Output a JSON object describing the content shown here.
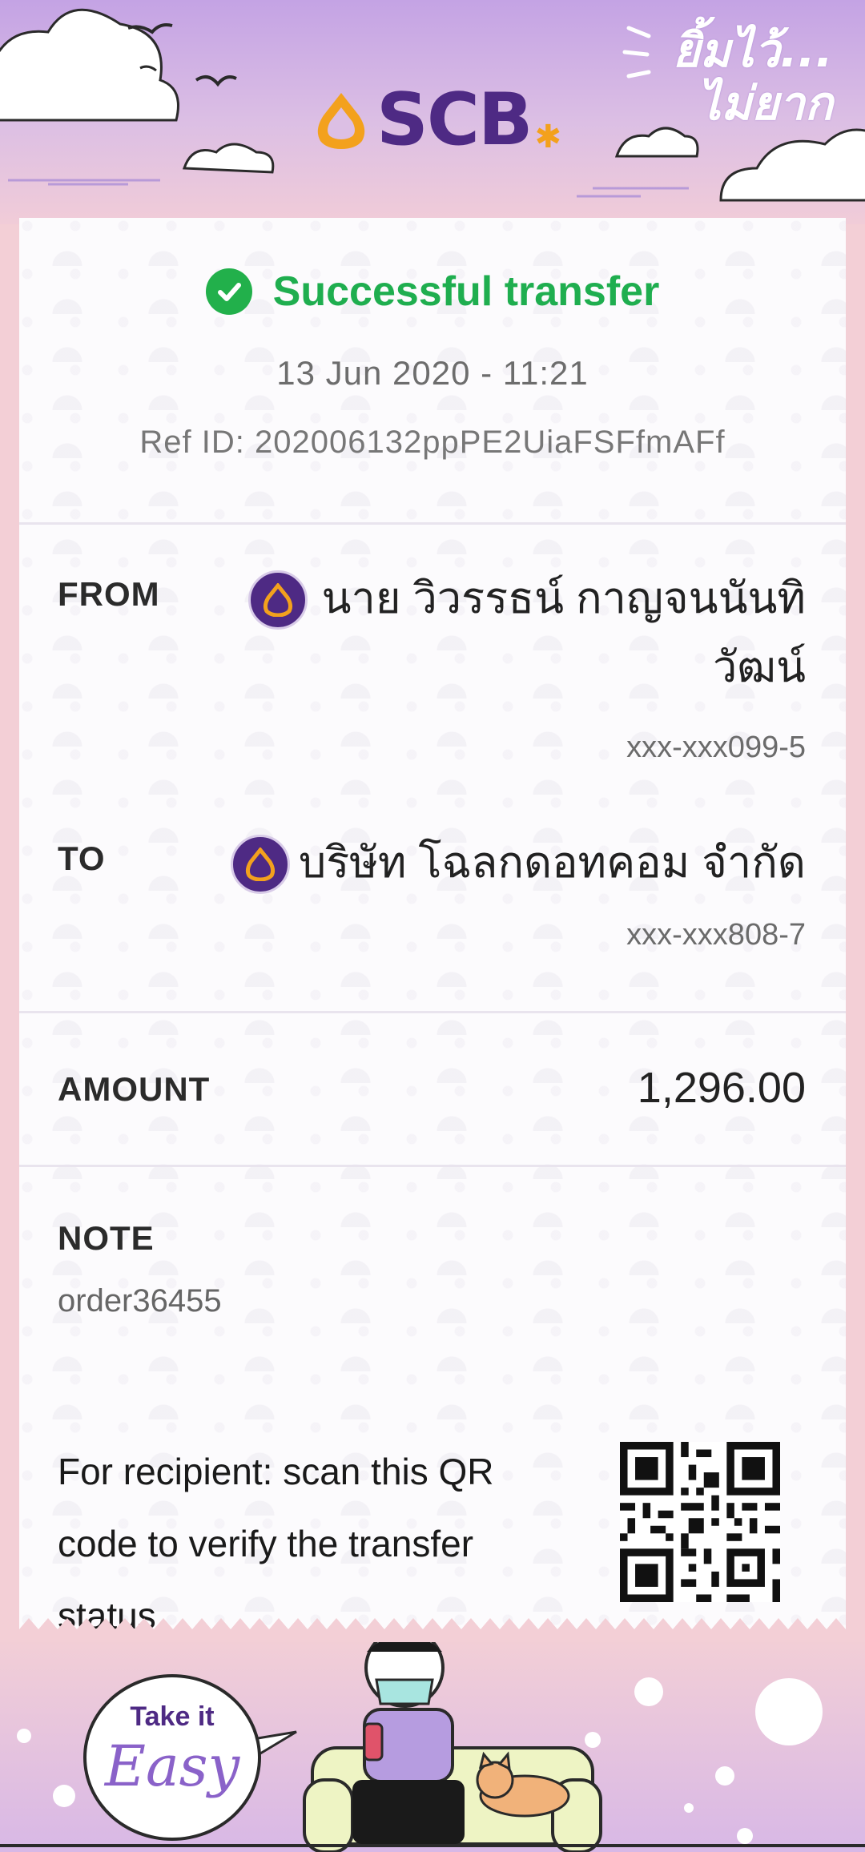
{
  "header": {
    "brand": "SCB",
    "tagline_line1": "ยิ้มไว้...",
    "tagline_line2": "ไม่ยาก"
  },
  "status": {
    "title": "Successful transfer",
    "datetime": "13 Jun 2020 - 11:21",
    "ref_label": "Ref ID:",
    "ref_id": "202006132ppPE2UiaFSFfmAFf"
  },
  "from": {
    "label": "FROM",
    "name_line1": "นาย วิวรรธน์ กาญจนนันทิ",
    "name_line2": "วัฒน์",
    "account": "xxx-xxx099-5"
  },
  "to": {
    "label": "TO",
    "name": "บริษัท โฉลกดอทคอม จำกัด",
    "account": "xxx-xxx808-7"
  },
  "amount": {
    "label": "AMOUNT",
    "value": "1,296.00"
  },
  "note": {
    "label": "NOTE",
    "value": "order36455"
  },
  "qr": {
    "text": "For recipient: scan this QR code to verify the transfer status."
  },
  "footer": {
    "bubble_top": "Take it",
    "bubble_easy": "Easy"
  },
  "colors": {
    "brand_purple": "#4e2a84",
    "success_green": "#1fae4f",
    "accent_gold": "#f3a11d"
  }
}
